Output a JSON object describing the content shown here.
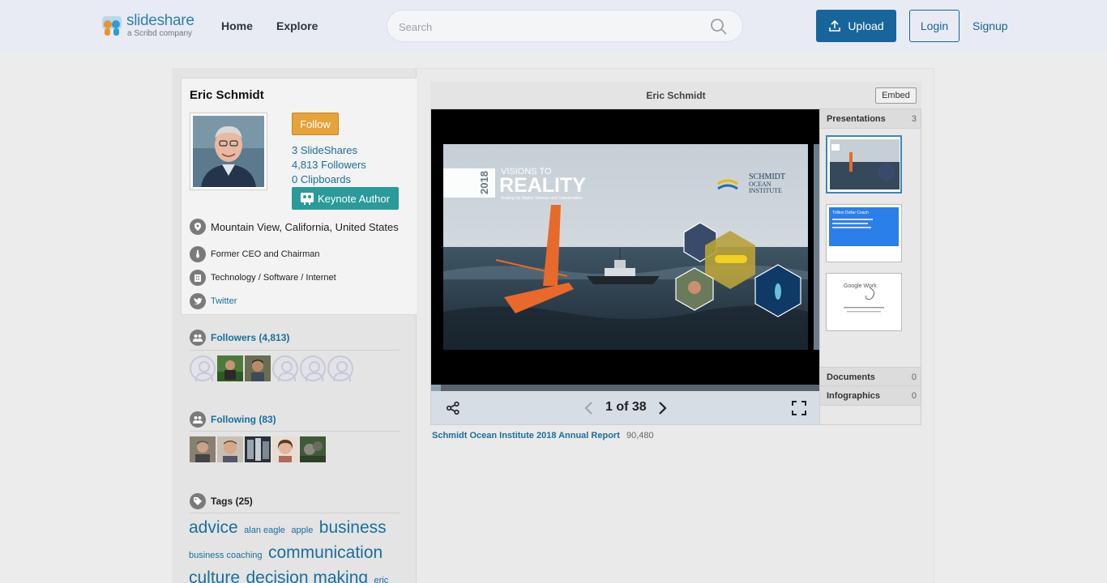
{
  "header": {
    "logo_word": "slideshare",
    "logo_sub": "a Scribd company",
    "nav": [
      "Home",
      "Explore"
    ],
    "search_placeholder": "Search",
    "upload_label": "Upload",
    "login_label": "Login",
    "signup_label": "Signup"
  },
  "profile": {
    "name": "Eric Schmidt",
    "follow_label": "Follow",
    "slideshares": "3 SlideShares",
    "followers": "4,813 Followers",
    "clipboards": "0 Clipboards",
    "keynote_label": "Keynote Author",
    "location": "Mountain View, California, United States",
    "role": "Former CEO and Chairman",
    "industry": "Technology / Software / Internet",
    "twitter": "Twitter"
  },
  "followers_section": {
    "title": "Followers (4,813)"
  },
  "following_section": {
    "title": "Following (83)"
  },
  "tags_section": {
    "title": "Tags (25)",
    "tags": [
      {
        "text": "advice",
        "size": "big"
      },
      {
        "text": "alan eagle",
        "size": "small"
      },
      {
        "text": "apple",
        "size": "small"
      },
      {
        "text": "business",
        "size": "big"
      },
      {
        "text": "business coaching",
        "size": "small"
      },
      {
        "text": "communication",
        "size": "big"
      },
      {
        "text": "culture",
        "size": "big"
      },
      {
        "text": "decision making",
        "size": "big"
      },
      {
        "text": "eric",
        "size": "small"
      }
    ]
  },
  "viewer": {
    "title": "Eric Schmidt",
    "embed_label": "Embed",
    "page_indicator": "1 of 38",
    "progress_fraction": 0.026,
    "slide": {
      "year": "2018",
      "headline_top": "VISIONS TO",
      "headline_main": "REALITY",
      "tagline": "Scaling Up Marine Science and Conservation",
      "org_line1": "SCHMIDT",
      "org_line2": "OCEAN",
      "org_line3": "INSTITUTE"
    }
  },
  "sidepanel": {
    "presentations": {
      "label": "Presentations",
      "count": "3"
    },
    "documents": {
      "label": "Documents",
      "count": "0"
    },
    "infographics": {
      "label": "Infographics",
      "count": "0"
    },
    "thumb2_text": "Trillion Dollar Coach",
    "thumb3_text": "Google Work"
  },
  "report": {
    "title": "Schmidt Ocean Institute 2018 Annual Report",
    "views": "90,480"
  },
  "colors": {
    "accent": "#18659b",
    "follow": "#e6a33a",
    "keynote": "#2a9a9a"
  }
}
